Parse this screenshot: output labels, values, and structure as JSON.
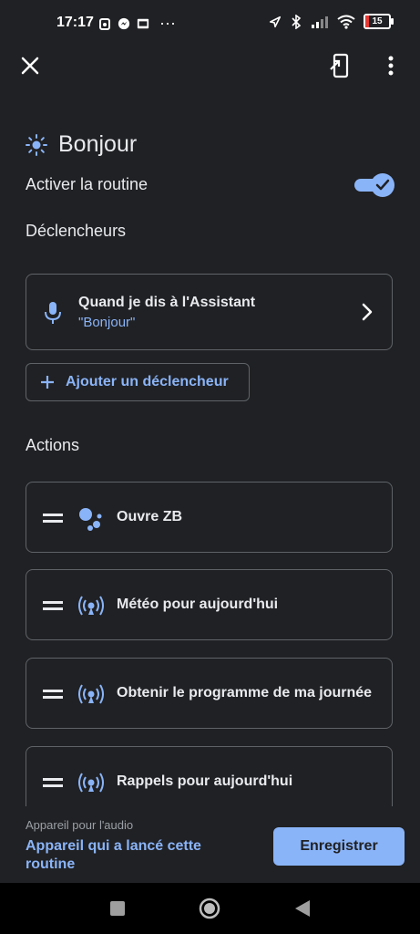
{
  "status_bar": {
    "time": "17:17",
    "dots": "···",
    "battery": "15"
  },
  "topbar": {},
  "routine": {
    "title": "Bonjour",
    "enable_label": "Activer la routine",
    "enabled": true
  },
  "triggers": {
    "section_label": "Déclencheurs",
    "items": [
      {
        "title": "Quand je dis à l'Assistant",
        "phrase": "\"Bonjour\""
      }
    ],
    "add_label": "Ajouter un déclencheur"
  },
  "actions": {
    "section_label": "Actions",
    "items": [
      {
        "label": "Ouvre ZB",
        "icon": "google-assistant-icon"
      },
      {
        "label": "Météo pour aujourd'hui",
        "icon": "broadcast-icon"
      },
      {
        "label": "Obtenir le programme de ma journée",
        "icon": "broadcast-icon"
      },
      {
        "label": "Rappels pour aujourd'hui",
        "icon": "broadcast-icon"
      }
    ]
  },
  "footer": {
    "audio_caption": "Appareil pour l'audio",
    "audio_value": "Appareil qui a lancé cette routine",
    "save_label": "Enregistrer"
  },
  "colors": {
    "background": "#202124",
    "accent": "#8ab4f8",
    "border": "#5f6368",
    "text": "#e8eaed"
  }
}
